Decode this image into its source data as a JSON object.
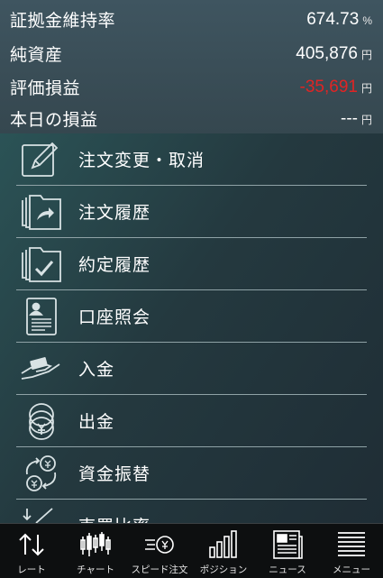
{
  "summary": {
    "margin_ratio": {
      "label": "証拠金維持率",
      "value": "674.73",
      "unit": "%"
    },
    "net_assets": {
      "label": "純資産",
      "value": "405,876",
      "unit": "円"
    },
    "valuation_pl": {
      "label": "評価損益",
      "value": "-35,691",
      "unit": "円",
      "color": "#e02424"
    },
    "today_pl": {
      "label": "本日の損益",
      "value": "---",
      "unit": "円"
    }
  },
  "menu": {
    "items": [
      {
        "label": "注文変更・取消",
        "icon": "pencil-edit-icon"
      },
      {
        "label": "注文履歴",
        "icon": "order-history-icon"
      },
      {
        "label": "約定履歴",
        "icon": "execution-history-icon"
      },
      {
        "label": "口座照会",
        "icon": "account-document-icon"
      },
      {
        "label": "入金",
        "icon": "deposit-hand-icon"
      },
      {
        "label": "出金",
        "icon": "coins-withdraw-icon"
      },
      {
        "label": "資金振替",
        "icon": "yen-transfer-icon"
      },
      {
        "label": "売買比率",
        "icon": "ratio-chart-icon"
      }
    ]
  },
  "tabbar": {
    "tabs": [
      {
        "label": "レート",
        "icon": "rate-arrows-icon"
      },
      {
        "label": "チャート",
        "icon": "candlestick-chart-icon"
      },
      {
        "label": "スピード注文",
        "icon": "speed-order-icon"
      },
      {
        "label": "ポジション",
        "icon": "position-bars-icon"
      },
      {
        "label": "ニュース",
        "icon": "news-icon"
      },
      {
        "label": "メニュー",
        "icon": "menu-list-icon"
      }
    ]
  },
  "colors": {
    "header_bg": "#3f5560",
    "menu_bg": "#24393f",
    "tabbar_bg": "#0d0f10",
    "negative": "#e02424",
    "divider": "#8fa2a6"
  }
}
